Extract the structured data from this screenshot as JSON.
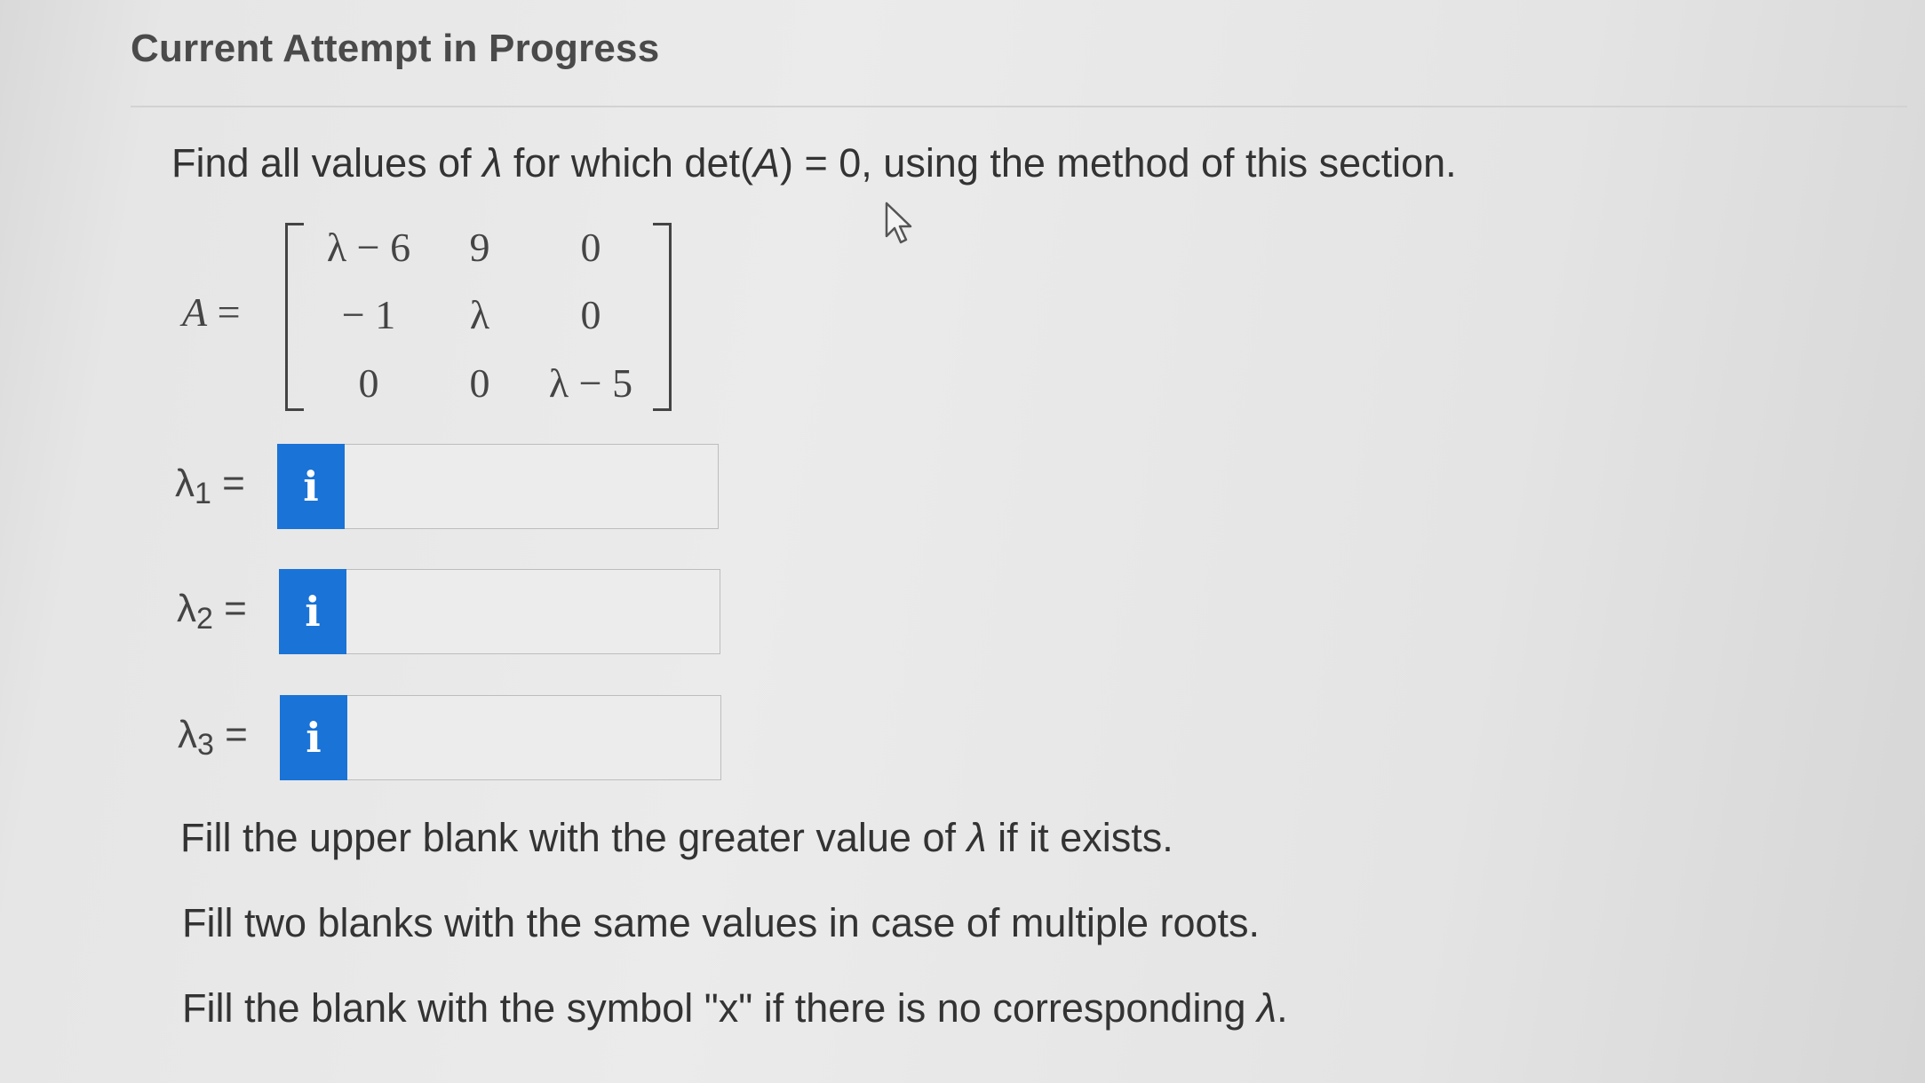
{
  "header": {
    "title": "Current Attempt in Progress"
  },
  "question": {
    "prefix": "Find all values of ",
    "lambda": "λ",
    "middle": " for which det(",
    "matrix_var": "A",
    "suffix": ") = 0, using the method of this section."
  },
  "matrix": {
    "label": "A",
    "equals": " =",
    "rows": [
      [
        "λ − 6",
        "9",
        "0"
      ],
      [
        "− 1",
        "λ",
        "0"
      ],
      [
        "0",
        "0",
        "λ − 5"
      ]
    ]
  },
  "answers": [
    {
      "label_base": "λ",
      "label_sub": "1",
      "equals": " =",
      "info_glyph": "i",
      "value": "",
      "placeholder": ""
    },
    {
      "label_base": "λ",
      "label_sub": "2",
      "equals": " =",
      "info_glyph": "i",
      "value": "",
      "placeholder": ""
    },
    {
      "label_base": "λ",
      "label_sub": "3",
      "equals": " =",
      "info_glyph": "i",
      "value": "",
      "placeholder": ""
    }
  ],
  "instructions": [
    {
      "text": "Fill the upper blank with the greater value of ",
      "lambda": "λ",
      "tail": " if it exists."
    },
    {
      "text": "Fill two blanks with the same values in case of multiple roots.",
      "lambda": "",
      "tail": ""
    },
    {
      "text": "Fill the blank with the symbol \"x\" if there is no corresponding ",
      "lambda": "λ",
      "tail": "."
    }
  ],
  "icons": {
    "info": "info-icon",
    "cursor": "mouse-pointer-icon"
  },
  "colors": {
    "info_button": "#1a73d6",
    "background": "#e8e8e8"
  }
}
